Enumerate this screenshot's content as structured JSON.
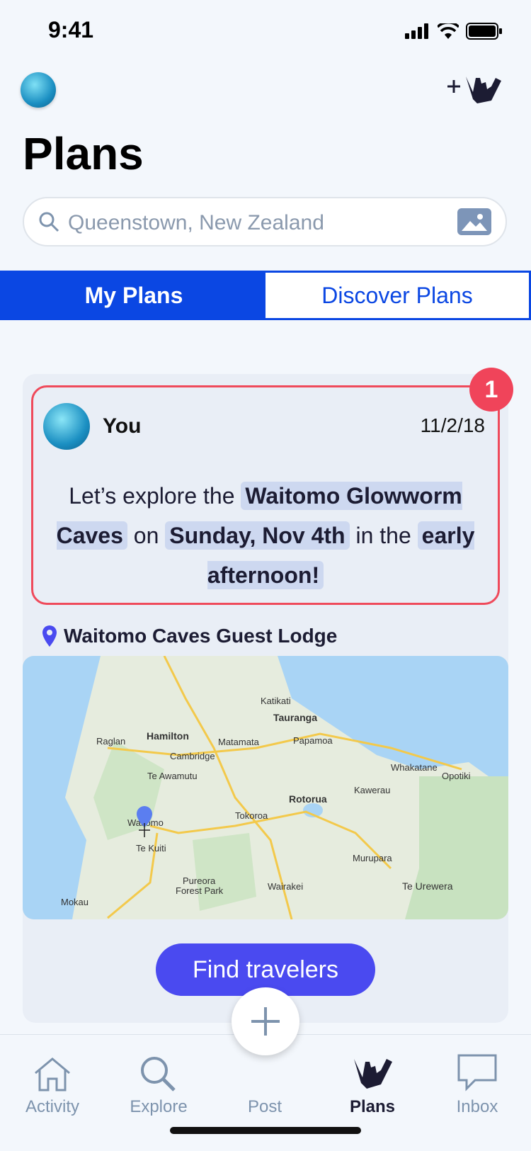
{
  "status_bar": {
    "time": "9:41"
  },
  "header": {
    "title": "Plans",
    "add_icon": "shaka-plus-icon"
  },
  "search": {
    "placeholder": "Queenstown, New Zealand"
  },
  "tabs": [
    {
      "label": "My Plans",
      "active": true
    },
    {
      "label": "Discover Plans",
      "active": false
    }
  ],
  "plan_card": {
    "badge": "1",
    "author": "You",
    "date": "11/2/18",
    "message": {
      "pre": "Let’s explore the",
      "place": "Waitomo Glowworm Caves",
      "mid1": "on",
      "day": "Sunday, Nov 4th",
      "mid2": "in the",
      "time": "early afternoon!"
    },
    "location": "Waitomo Caves Guest Lodge",
    "map_labels": {
      "hamilton": "Hamilton",
      "raglan": "Raglan",
      "cambridge": "Cambridge",
      "te_awamutu": "Te Awamutu",
      "matamata": "Matamata",
      "katikati": "Katikati",
      "tauranga": "Tauranga",
      "papamoa": "Papamoa",
      "whakatane": "Whakatane",
      "opotiki": "Opotiki",
      "kawerau": "Kawerau",
      "rotorua": "Rotorua",
      "tokoroa": "Tokoroa",
      "waitomo": "Waitomo",
      "te_kuiti": "Te Kuiti",
      "murupara": "Murupara",
      "pureora": "Pureora",
      "forest_park": "Forest Park",
      "wairakei": "Wairakei",
      "te_urewera": "Te Urewera",
      "mokau": "Mokau"
    },
    "button": "Find travelers"
  },
  "tabbar": [
    {
      "label": "Activity",
      "icon": "home-icon"
    },
    {
      "label": "Explore",
      "icon": "search-icon"
    },
    {
      "label": "Post",
      "icon": "plus-icon"
    },
    {
      "label": "Plans",
      "icon": "shaka-icon",
      "active": true
    },
    {
      "label": "Inbox",
      "icon": "chat-bubble-icon"
    }
  ]
}
